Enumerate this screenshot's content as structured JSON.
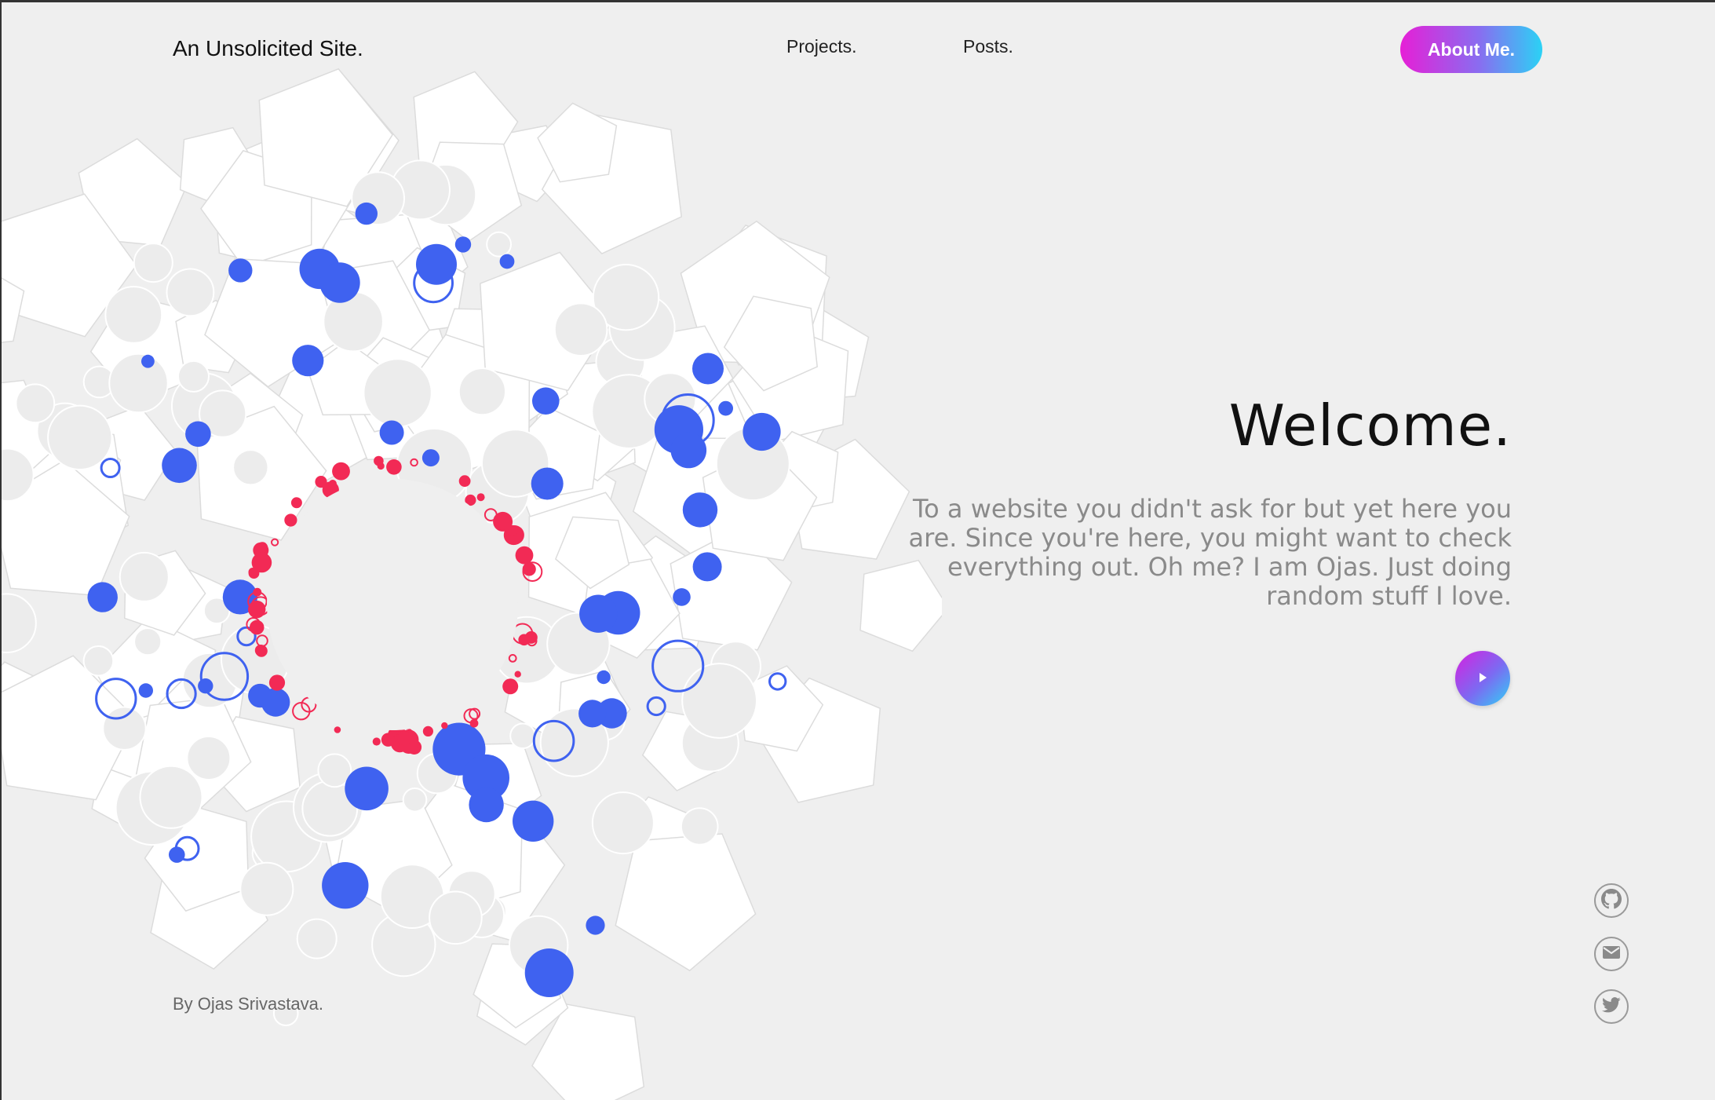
{
  "header": {
    "brand": "An Unsolicited Site.",
    "nav": {
      "projects": "Projects.",
      "posts": "Posts."
    },
    "cta": "About Me."
  },
  "hero": {
    "title": "Welcome.",
    "intro": "To a website you didn't ask for but yet here you are. Since you're here, you might want to check everything out. Oh me? I am Ojas. Just doing random stuff I love.",
    "play_icon": "play-icon"
  },
  "social": [
    "github-icon",
    "mail-icon",
    "twitter-icon"
  ],
  "footer": {
    "byline": "By Ojas Srivastava."
  },
  "colors": {
    "background": "#efefef",
    "accent_blue": "#3f62f0",
    "accent_red": "#f22a55",
    "gradient_start": "#e61fd6",
    "gradient_end": "#2bd2f5"
  }
}
